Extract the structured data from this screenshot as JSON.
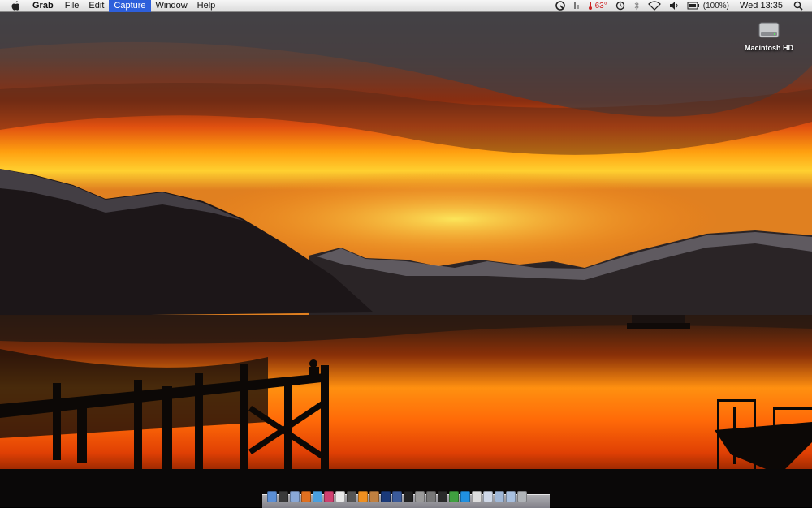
{
  "menubar": {
    "app_name": "Grab",
    "menus": [
      "File",
      "Edit",
      "Capture",
      "Window",
      "Help"
    ],
    "active_menu": "Capture",
    "status": {
      "temperature": "63°",
      "battery": "(100%)",
      "clock": "Wed 13:35"
    },
    "status_icons": [
      "quicksilver-icon",
      "memory-icon",
      "thermometer-icon",
      "time-machine-icon",
      "bluetooth-icon",
      "wifi-icon",
      "volume-icon",
      "battery-icon",
      "spotlight-icon"
    ]
  },
  "desktop": {
    "icons": [
      {
        "label": "Macintosh HD",
        "icon": "hard-drive-icon"
      }
    ],
    "wallpaper": "sunset-lake"
  },
  "dock": {
    "icons": [
      {
        "name": "finder",
        "color": "#5b8fd6"
      },
      {
        "name": "dashboard",
        "color": "#3a3a3a"
      },
      {
        "name": "mail",
        "color": "#8aa9d8"
      },
      {
        "name": "firefox",
        "color": "#e07020"
      },
      {
        "name": "safari",
        "color": "#4aa0e0"
      },
      {
        "name": "itunes",
        "color": "#d04070"
      },
      {
        "name": "ical",
        "color": "#e8e8e8"
      },
      {
        "name": "camera",
        "color": "#555555"
      },
      {
        "name": "vlc",
        "color": "#f09020"
      },
      {
        "name": "preview",
        "color": "#c08040"
      },
      {
        "name": "photoshop",
        "color": "#1a3a7a"
      },
      {
        "name": "spaces",
        "color": "#3a5a9a"
      },
      {
        "name": "activity",
        "color": "#222222"
      },
      {
        "name": "grab",
        "color": "#9a9a9a"
      },
      {
        "name": "system-preferences",
        "color": "#777777"
      },
      {
        "name": "terminal",
        "color": "#2a2a2a"
      },
      {
        "name": "utorrent",
        "color": "#40a040"
      },
      {
        "name": "skype",
        "color": "#2090e0"
      },
      {
        "name": "textedit",
        "color": "#dddddd"
      },
      {
        "name": "documents",
        "color": "#cfd8e8"
      },
      {
        "name": "downloads",
        "color": "#a0b8d8"
      },
      {
        "name": "applications",
        "color": "#a8c0e0"
      },
      {
        "name": "trash",
        "color": "#b0b4b8"
      }
    ]
  }
}
